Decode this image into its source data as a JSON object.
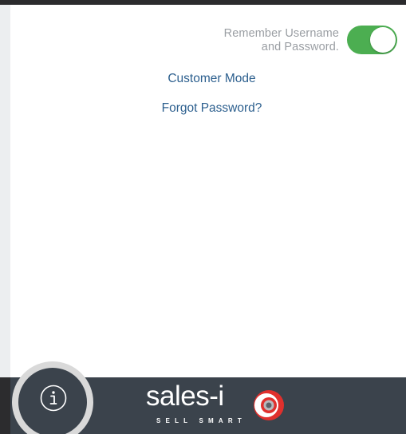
{
  "remember": {
    "line1": "Remember Username",
    "line2": "and Password.",
    "enabled": true,
    "on_color": "#4cae51"
  },
  "links": {
    "customer_mode": "Customer Mode",
    "forgot_password": "Forgot Password?",
    "color": "#2c5f8e"
  },
  "footer": {
    "info_icon": "info-icon",
    "logo": {
      "word": "sales-i",
      "tagline": "SELL SMART",
      "accent_color": "#e0302d"
    },
    "background": "#3b434c"
  }
}
